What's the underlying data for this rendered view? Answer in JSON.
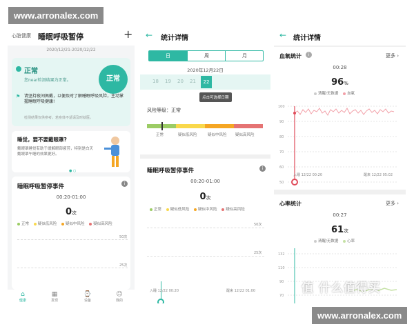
{
  "watermarks": {
    "top": "www.arronalex.com",
    "bottom": "www.arronalex.com",
    "overlay": "值 什么值得买"
  },
  "colors": {
    "accent": "#2eb8a3",
    "normal": "#9ccc65",
    "low": "#f9d84b",
    "medium": "#f5a623",
    "high": "#e57373",
    "spo2_line": "#f2a0a8",
    "hr_line": "#c5e1a5"
  },
  "screen1": {
    "app": "心脏健康",
    "title": "睡眠呼吸暂停",
    "plus_icon": "plus-icon",
    "date_range": "2020/12/21-2020/12/22",
    "status_card": {
      "status": "正常",
      "desc": "您near检测结果为正常。",
      "badge": "正常",
      "tip": "请坚持夜间佩戴，以便及时了解睡眠呼吸风险，主动掌握睡眠呼吸健康!",
      "note": "检测结果仅供参考，若身体不适请及时就医。"
    },
    "mask_card": {
      "title": "睡觉，要不要戴眼罩?",
      "body": "戴眼罩睡觉有助于缓解眼部疲劳，特别是白天戴眼罩午睡的效果更好。"
    },
    "events_card": {
      "title": "睡眠呼吸暂停事件",
      "time": "00:20-01:00",
      "count": "0",
      "unit": "次",
      "legend": [
        "正常",
        "疑似低风险",
        "疑似中风险",
        "疑似高风险"
      ],
      "y_ticks": [
        "50次",
        "25次"
      ]
    },
    "bottom_nav": [
      "健康",
      "发现",
      "设备",
      "我的"
    ]
  },
  "screen2": {
    "title": "统计详情",
    "tabs": [
      "日",
      "周",
      "月"
    ],
    "date": "2020年12月22日",
    "days": [
      "18",
      "19",
      "20",
      "21",
      "22"
    ],
    "tooltip": "点击可选择日期",
    "risk_label": "风险等级：正常",
    "risk_levels": [
      "正常",
      "疑似低风险",
      "疑似中风险",
      "疑似高风险"
    ],
    "events_title": "睡眠呼吸暂停事件",
    "time": "00:20-01:00",
    "count": "0",
    "unit": "次",
    "y_ticks": [
      "50次",
      "25次"
    ],
    "start": "入睡 12/22 00:20",
    "end": "醒来 12/22 01:00"
  },
  "screen3": {
    "title": "统计详情",
    "spo2": {
      "title": "血氧统计",
      "more": "更多",
      "time": "00:28",
      "value": "96",
      "unit": "%",
      "legend": [
        "清醒/无数据",
        "血氧"
      ],
      "y_ticks": [
        "100",
        "90",
        "80",
        "70",
        "60",
        "50"
      ],
      "start": "入睡 12/22 00:20",
      "end": "醒来 12/22 05:02"
    },
    "hr": {
      "title": "心率统计",
      "more": "更多",
      "time": "00:27",
      "value": "61",
      "unit": "次",
      "legend": [
        "清醒/无数据",
        "心率"
      ],
      "y_ticks": [
        "132",
        "110",
        "90",
        "70"
      ]
    }
  }
}
